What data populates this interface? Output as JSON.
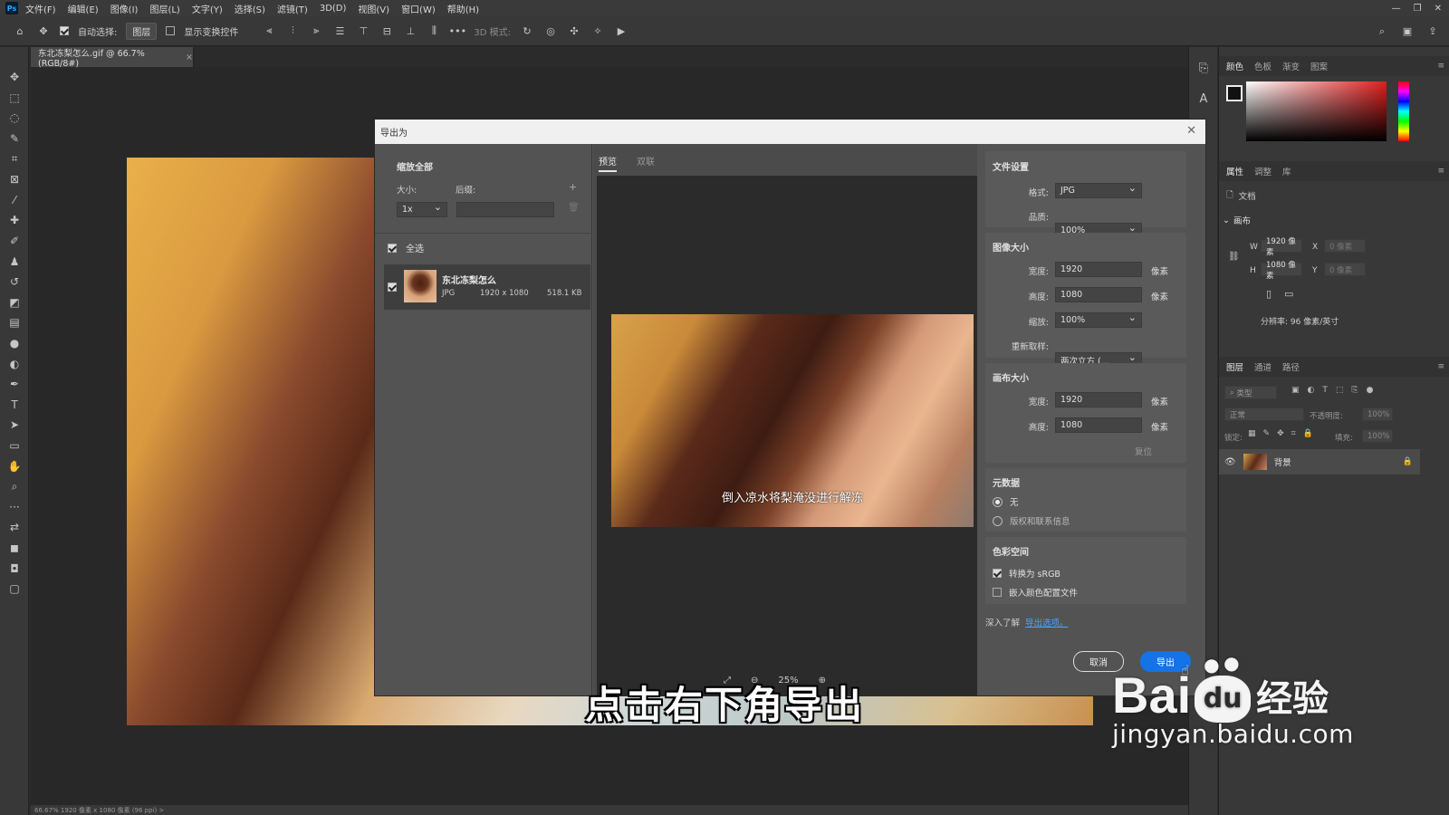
{
  "menubar": {
    "logo": "Ps",
    "items": [
      "文件(F)",
      "编辑(E)",
      "图像(I)",
      "图层(L)",
      "文字(Y)",
      "选择(S)",
      "滤镜(T)",
      "3D(D)",
      "视图(V)",
      "窗口(W)",
      "帮助(H)"
    ]
  },
  "optionsbar": {
    "auto_select_label": "自动选择:",
    "auto_select_target": "图层",
    "show_transform_label": "显示变换控件",
    "mode_3d_label": "3D 模式:"
  },
  "document": {
    "tab_title": "东北冻梨怎么.gif @ 66.7%(RGB/8#)",
    "status": "66.67%   1920 像素 x 1080 像素 (96 ppi)   >"
  },
  "panels": {
    "color_tabs": [
      "颜色",
      "色板",
      "渐变",
      "图案"
    ],
    "props_tabs": [
      "属性",
      "调整",
      "库"
    ],
    "doc_label": "文档",
    "canvas_label": "画布",
    "w_label": "W",
    "w_value": "1920 像素",
    "h_label": "H",
    "h_value": "1080 像素",
    "x_label": "X",
    "y_label": "Y",
    "x_placeholder": "0 像素",
    "y_placeholder": "0 像素",
    "resolution": "分辨率: 96 像素/英寸",
    "layers_tabs": [
      "图层",
      "通道",
      "路径"
    ],
    "layer_filter": "类型",
    "blend_mode": "正常",
    "opacity_label": "不透明度:",
    "opacity_value": "100%",
    "lock_label": "锁定:",
    "fill_label": "填充:",
    "fill_value": "100%",
    "layer_name": "背景"
  },
  "dialog": {
    "title": "导出为",
    "scale_all": "缩放全部",
    "size_label": "大小:",
    "suffix_label": "后缀:",
    "scale_value": "1x",
    "select_all": "全选",
    "asset_name": "东北冻梨怎么",
    "asset_format": "JPG",
    "asset_dims": "1920 x 1080",
    "asset_size": "518.1 KB",
    "tab_preview": "预览",
    "tab_dual": "双联",
    "preview_caption": "倒入凉水将梨淹没进行解冻",
    "zoom": "25%",
    "file_settings": "文件设置",
    "format_label": "格式:",
    "format_value": "JPG",
    "quality_label": "品质:",
    "quality_value": "100%",
    "image_size": "图像大小",
    "width_label": "宽度:",
    "width_value": "1920",
    "height_label": "高度:",
    "height_value": "1080",
    "unit": "像素",
    "scale_label": "缩放:",
    "scale_pct": "100%",
    "resample_label": "重新取样:",
    "resample_value": "两次立方 (...",
    "canvas_size": "画布大小",
    "canvas_width": "1920",
    "canvas_height": "1080",
    "reset": "复位",
    "metadata": "元数据",
    "meta_none": "无",
    "meta_copyright": "版权和联系信息",
    "colorspace": "色彩空间",
    "convert_srgb": "转换为 sRGB",
    "embed_profile": "嵌入颜色配置文件",
    "learn_more": "深入了解",
    "export_options_link": "导出选项。",
    "cancel": "取消",
    "export": "导出"
  },
  "subtitle": "点击右下角导出",
  "watermark": {
    "brand": "Bai",
    "paw": "du",
    "jingyan": "经验",
    "url": "jingyan.baidu.com"
  },
  "colors": {
    "accent": "#1473e6",
    "link": "#4aa3ff",
    "bg": "#2b2b2b"
  }
}
